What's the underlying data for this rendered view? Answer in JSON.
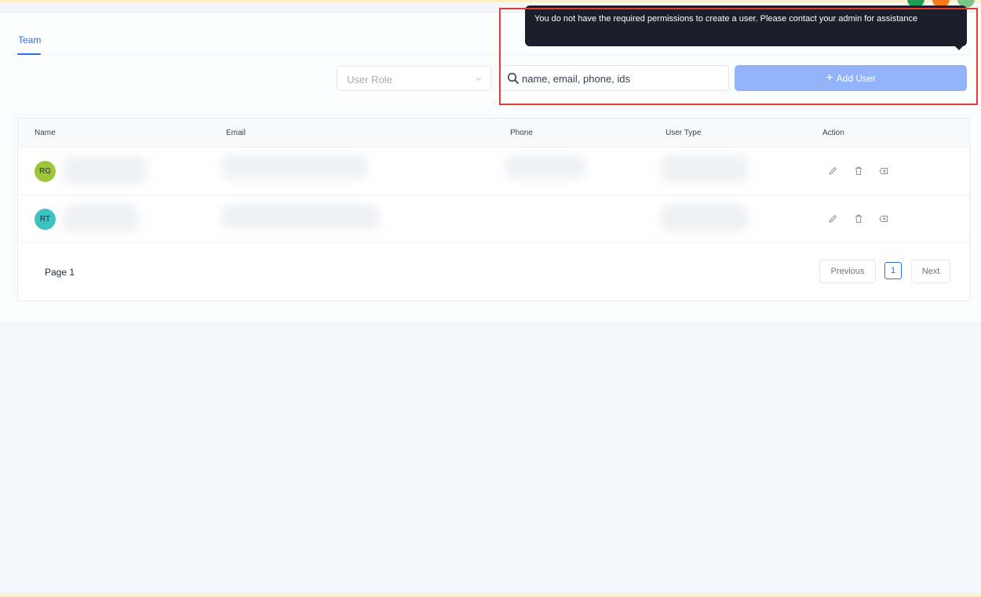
{
  "tabs": [
    {
      "label": "Team",
      "active": true
    }
  ],
  "filters": {
    "role_placeholder": "User Role",
    "search_placeholder": "name, email, phone, ids"
  },
  "add_button": {
    "icon": "plus-icon",
    "label": "Add User",
    "disabled": true
  },
  "tooltip": {
    "text": "You do not have the required permissions to create a user. Please contact your admin for assistance"
  },
  "table": {
    "columns": [
      "Name",
      "Email",
      "Phone",
      "User Type",
      "Action"
    ],
    "rows": [
      {
        "initials": "RG",
        "avatar_color": "#9fc63a"
      },
      {
        "initials": "RT",
        "avatar_color": "#3fc1c0"
      }
    ],
    "actions": [
      "edit-icon",
      "delete-icon",
      "remove-icon"
    ]
  },
  "pagination": {
    "page_label": "Page 1",
    "previous_label": "Previous",
    "current_page": "1",
    "next_label": "Next"
  },
  "colors": {
    "accent": "#2f6fe8",
    "add_button_bg": "#92b3f8",
    "tooltip_bg": "#1b1f2a",
    "highlight_border": "#e53935"
  }
}
